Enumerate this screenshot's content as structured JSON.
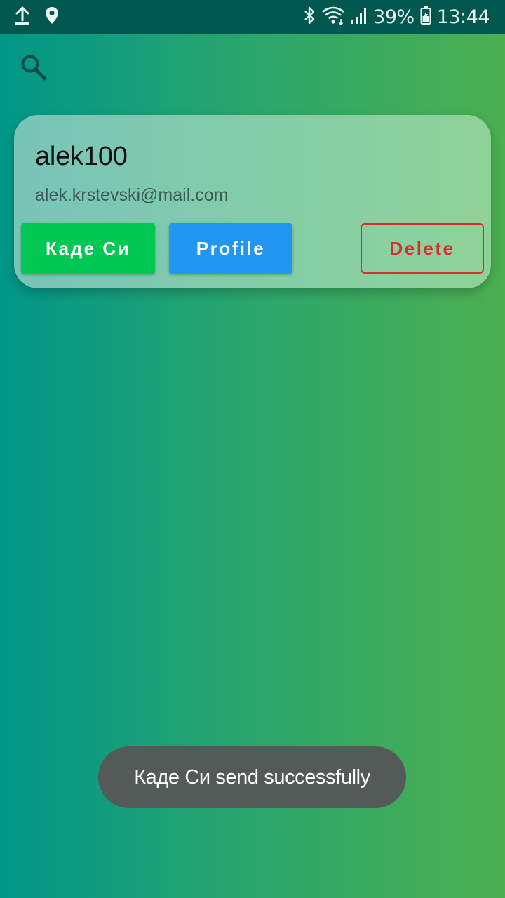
{
  "status_bar": {
    "battery": "39%",
    "time": "13:44",
    "icons": [
      "upload-icon",
      "location-icon",
      "bluetooth-icon",
      "wifi-icon",
      "signal-icon",
      "battery-icon"
    ]
  },
  "toolbar": {
    "search_icon": "search-icon"
  },
  "user_card": {
    "username": "alek100",
    "email": "alek.krstevski@mail.com",
    "buttons": {
      "kade_si": "Каде Си",
      "profile": "Profile",
      "delete": "Delete"
    }
  },
  "toast": {
    "message": "Каде Си send successfully"
  },
  "colors": {
    "status_bar": "#00574d",
    "gradient_start": "#009688",
    "gradient_end": "#4caf50",
    "kade_button": "#00c853",
    "profile_button": "#2196f3",
    "delete_accent": "#d32f2f",
    "toast_bg": "#545a57"
  }
}
